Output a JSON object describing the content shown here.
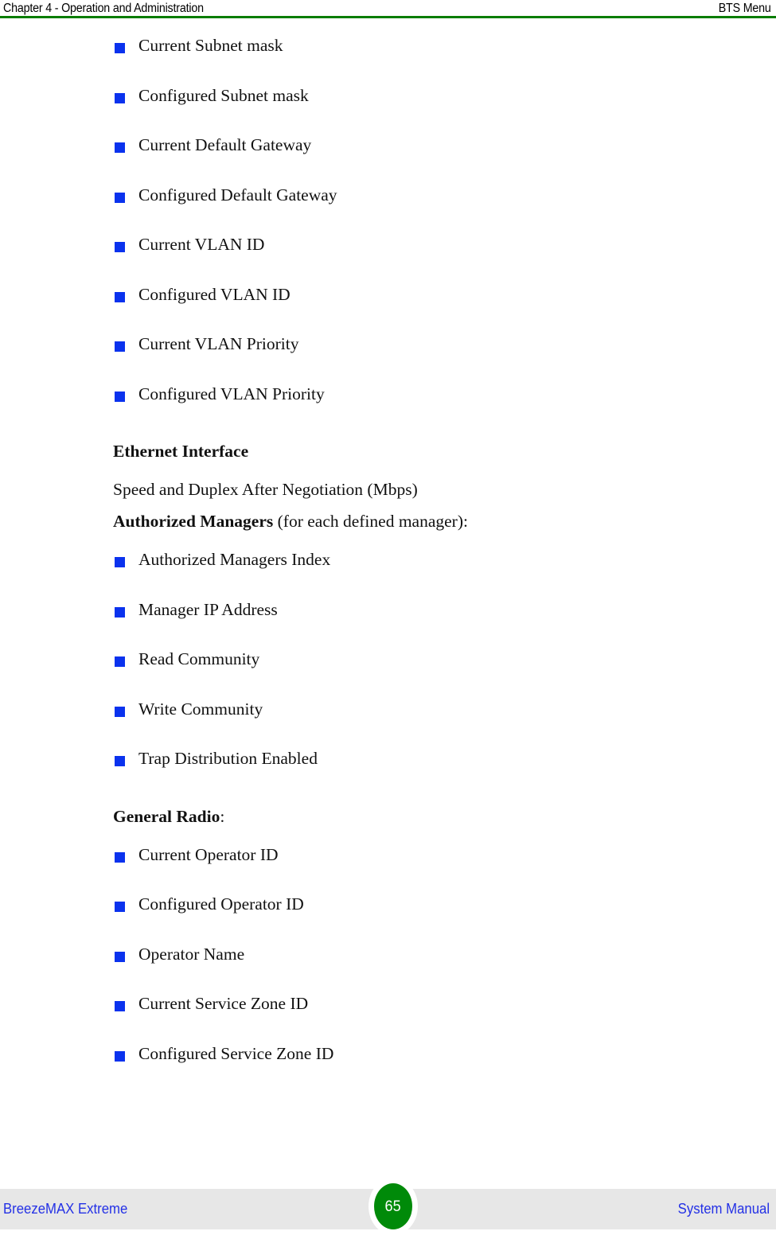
{
  "header": {
    "left": "Chapter 4 - Operation and Administration",
    "right": "BTS Menu",
    "rule_color": "#0a7d00"
  },
  "colors": {
    "bullet": "#0a32ee",
    "header_rule": "#0a7d00",
    "footer_band": "#e7e7e7",
    "footer_text": "#2431e6",
    "badge": "#008a09",
    "badge_text": "#ffffff"
  },
  "content": {
    "ip_bullets": [
      {
        "label": "Current Subnet mask"
      },
      {
        "label": "Configured Subnet mask"
      },
      {
        "label": "Current Default Gateway"
      },
      {
        "label": "Configured Default Gateway"
      },
      {
        "label": "Current VLAN ID"
      },
      {
        "label": "Configured VLAN ID"
      },
      {
        "label": "Current VLAN Priority"
      },
      {
        "label": "Configured VLAN Priority"
      }
    ],
    "ethernet_heading": "Ethernet Interface",
    "ethernet_line": "Speed and Duplex After Negotiation (Mbps)",
    "authorized_managers": {
      "lead": "Authorized Managers",
      "tail": " (for each defined manager):"
    },
    "manager_bullets": [
      {
        "label": "Authorized Managers Index"
      },
      {
        "label": "Manager IP Address"
      },
      {
        "label": "Read Community"
      },
      {
        "label": "Write Community"
      },
      {
        "label": "Trap Distribution Enabled"
      }
    ],
    "general_radio": {
      "lead": "General Radio",
      "tail": ":"
    },
    "radio_bullets": [
      {
        "label": "Current Operator ID"
      },
      {
        "label": "Configured Operator ID"
      },
      {
        "label": "Operator Name"
      },
      {
        "label": "Current Service Zone ID"
      },
      {
        "label": "Configured Service Zone ID"
      }
    ]
  },
  "footer": {
    "left": "BreezeMAX Extreme",
    "right": "System Manual",
    "page_number": "65"
  }
}
